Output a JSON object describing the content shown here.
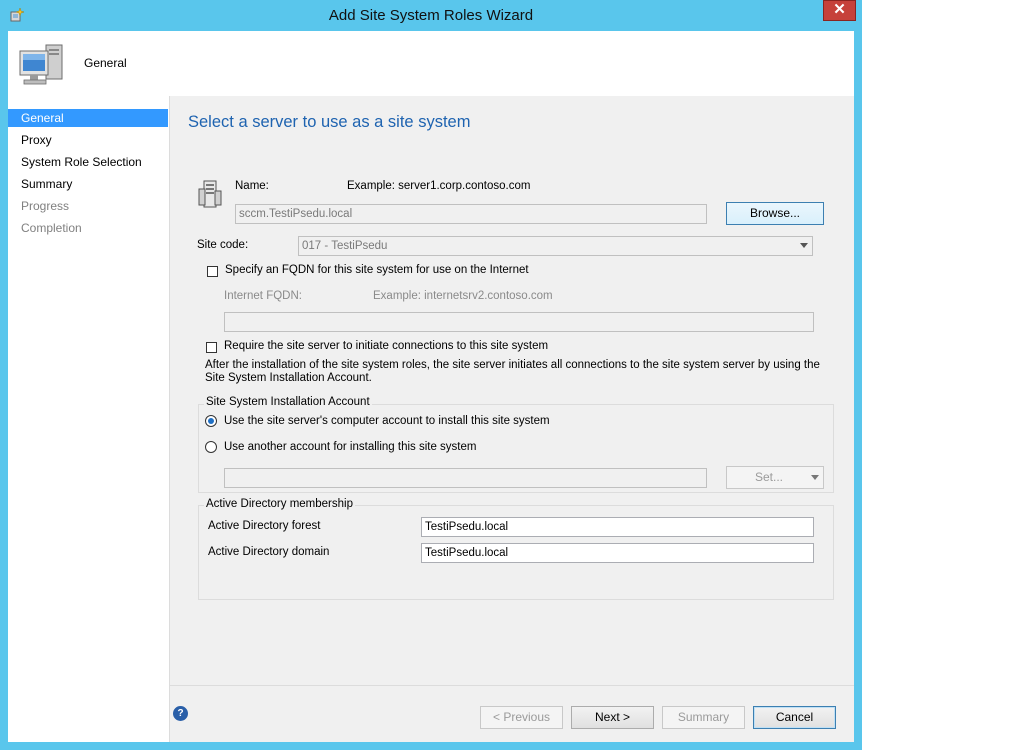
{
  "window": {
    "title": "Add Site System Roles Wizard",
    "close_glyph": "✕",
    "app_icon": "wizard-icon",
    "colors": {
      "frame": "#59c6ec",
      "close": "#c6413a",
      "heading": "#1e63b0",
      "selection": "#3399ff"
    }
  },
  "header": {
    "title": "General",
    "icon": "computer-icon"
  },
  "nav": {
    "items": [
      {
        "label": "General",
        "state": "selected"
      },
      {
        "label": "Proxy",
        "state": "enabled"
      },
      {
        "label": "System Role Selection",
        "state": "enabled"
      },
      {
        "label": "Summary",
        "state": "enabled"
      },
      {
        "label": "Progress",
        "state": "disabled"
      },
      {
        "label": "Completion",
        "state": "disabled"
      }
    ]
  },
  "page": {
    "heading": "Select a server to use as a site system",
    "server_icon": "server-icon",
    "name_label": "Name:",
    "name_example": "Example: server1.corp.contoso.com",
    "name_value": "sccm.TestiPsedu.local",
    "browse_button": "Browse...",
    "site_code_label": "Site code:",
    "site_code_value": "017 - TestiPsedu",
    "fqdn_checkbox_label": "Specify an FQDN for this site system for use on the Internet",
    "fqdn_checked": false,
    "internet_fqdn_label": "Internet FQDN:",
    "internet_fqdn_example": "Example: internetsrv2.contoso.com",
    "internet_fqdn_value": "",
    "require_checkbox_label": "Require the site server to initiate connections to this site system",
    "require_checked": false,
    "require_description": "After the  installation of the site system roles, the site server initiates all connections to the site system server by using the Site System Installation Account.",
    "install_account": {
      "group_title": "Site System Installation Account",
      "option_computer": "Use the site server's computer account to install this site system",
      "option_other": "Use another account for installing this site system",
      "selected": "computer",
      "account_value": "",
      "set_button": "Set..."
    },
    "ad_membership": {
      "group_title": "Active Directory membership",
      "forest_label": "Active Directory forest",
      "forest_value": "TestiPsedu.local",
      "domain_label": "Active Directory domain",
      "domain_value": "TestiPsedu.local"
    }
  },
  "footer": {
    "help_glyph": "?",
    "previous": "< Previous",
    "next": "Next >",
    "summary": "Summary",
    "cancel": "Cancel"
  }
}
